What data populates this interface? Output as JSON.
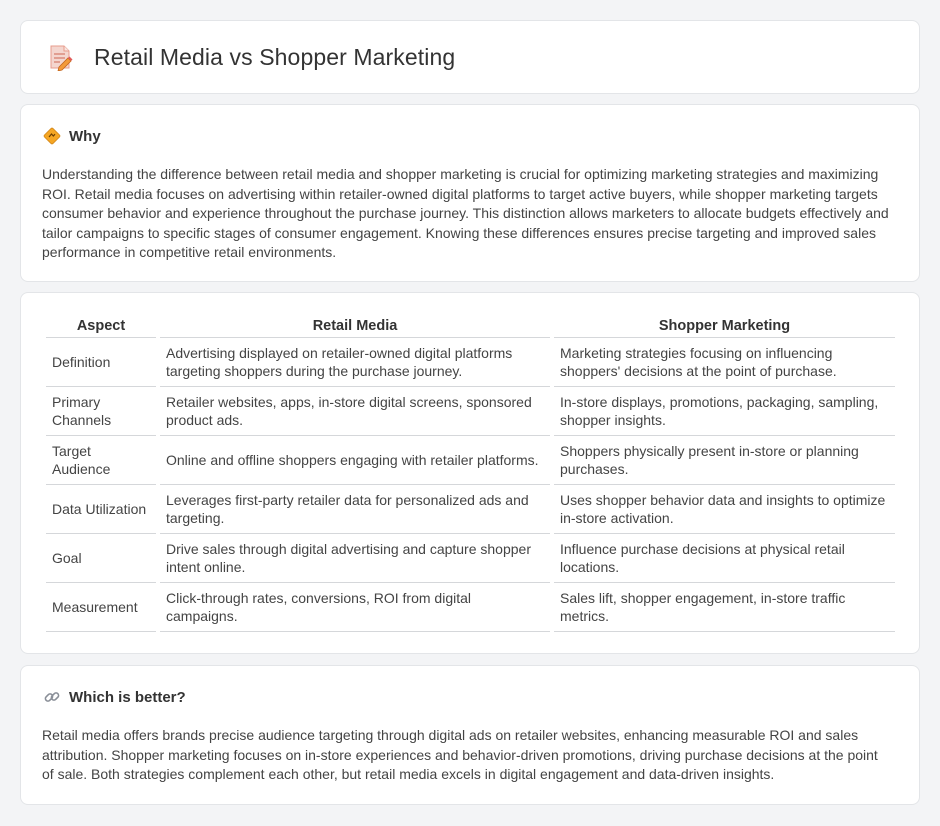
{
  "header": {
    "title": "Retail Media vs Shopper Marketing",
    "icon": "document-pencil-icon"
  },
  "why": {
    "title": "Why",
    "icon": "diamond-sign-icon",
    "text": "Understanding the difference between retail media and shopper marketing is crucial for optimizing marketing strategies and maximizing ROI. Retail media focuses on advertising within retailer-owned digital platforms to target active buyers, while shopper marketing targets consumer behavior and experience throughout the purchase journey. This distinction allows marketers to allocate budgets effectively and tailor campaigns to specific stages of consumer engagement. Knowing these differences ensures precise targeting and improved sales performance in competitive retail environments."
  },
  "comparison": {
    "headers": [
      "Aspect",
      "Retail Media",
      "Shopper Marketing"
    ],
    "rows": [
      {
        "aspect": "Definition",
        "retail_media": "Advertising displayed on retailer-owned digital platforms targeting shoppers during the purchase journey.",
        "shopper_marketing": "Marketing strategies focusing on influencing shoppers' decisions at the point of purchase."
      },
      {
        "aspect": "Primary Channels",
        "retail_media": "Retailer websites, apps, in-store digital screens, sponsored product ads.",
        "shopper_marketing": "In-store displays, promotions, packaging, sampling, shopper insights."
      },
      {
        "aspect": "Target Audience",
        "retail_media": "Online and offline shoppers engaging with retailer platforms.",
        "shopper_marketing": "Shoppers physically present in-store or planning purchases."
      },
      {
        "aspect": "Data Utilization",
        "retail_media": "Leverages first-party retailer data for personalized ads and targeting.",
        "shopper_marketing": "Uses shopper behavior data and insights to optimize in-store activation."
      },
      {
        "aspect": "Goal",
        "retail_media": "Drive sales through digital advertising and capture shopper intent online.",
        "shopper_marketing": "Influence purchase decisions at physical retail locations."
      },
      {
        "aspect": "Measurement",
        "retail_media": "Click-through rates, conversions, ROI from digital campaigns.",
        "shopper_marketing": "Sales lift, shopper engagement, in-store traffic metrics."
      }
    ]
  },
  "better": {
    "title": "Which is better?",
    "icon": "link-icon",
    "text": "Retail media offers brands precise audience targeting through digital ads on retailer websites, enhancing measurable ROI and sales attribution. Shopper marketing focuses on in-store experiences and behavior-driven promotions, driving purchase decisions at the point of sale. Both strategies complement each other, but retail media excels in digital engagement and data-driven insights."
  }
}
